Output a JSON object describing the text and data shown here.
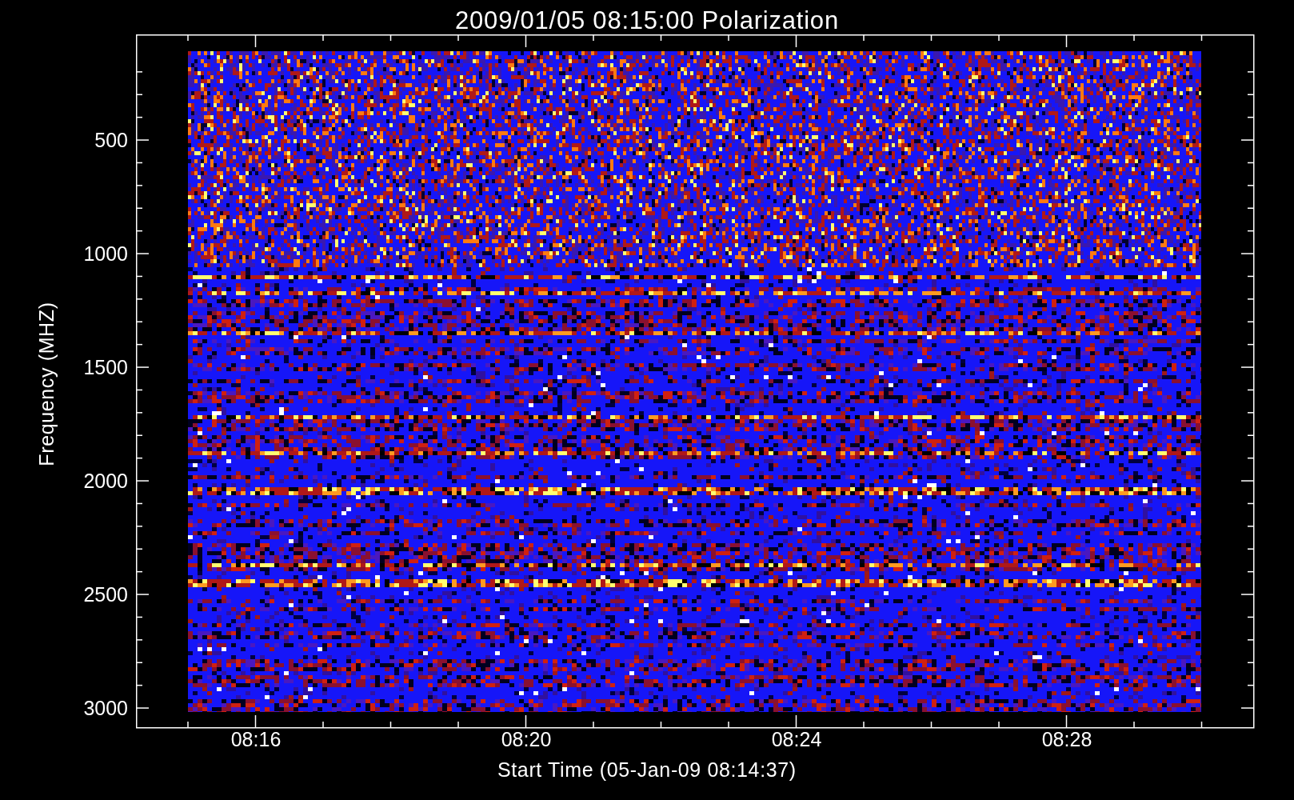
{
  "title": "2009/01/05 08:15:00 Polarization",
  "y_axis": {
    "label": "Frequency (MHZ)",
    "ticks": [
      "500",
      "1000",
      "1500",
      "2000",
      "2500",
      "3000"
    ]
  },
  "x_axis": {
    "label": "Start Time (05-Jan-09 08:14:37)",
    "ticks": [
      "08:16",
      "08:20",
      "08:24",
      "08:28"
    ]
  }
}
